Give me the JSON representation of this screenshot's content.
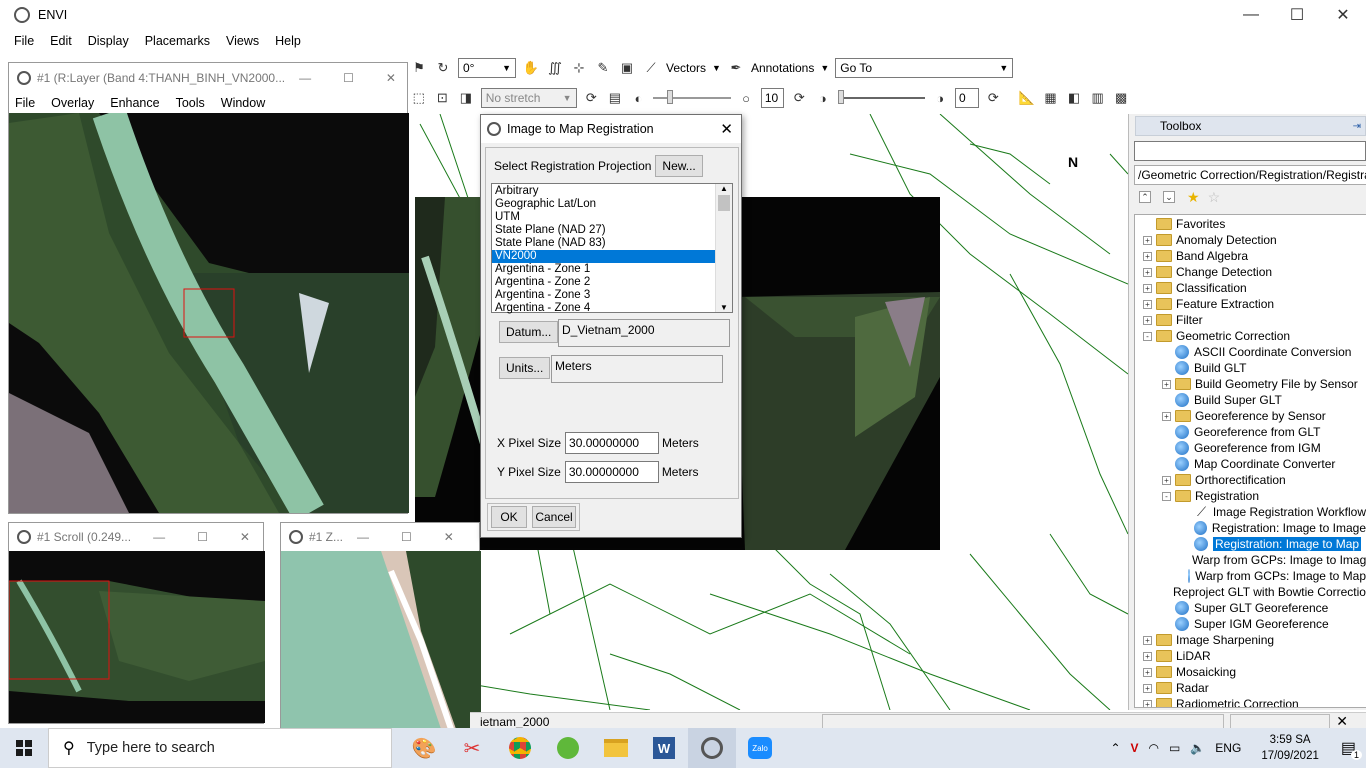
{
  "main_window": {
    "title": "ENVI",
    "menu": [
      "File",
      "Edit",
      "Display",
      "Placemarks",
      "Views",
      "Help"
    ],
    "controls": [
      "—",
      "☐",
      "✕"
    ]
  },
  "toolbar": {
    "rotation": "0°",
    "vectors": "Vectors",
    "annotations": "Annotations",
    "goto": "Go To",
    "stretch": "No stretch",
    "brightness_val": "10",
    "transparency_val": "0"
  },
  "layer_window": {
    "title": "#1 (R:Layer (Band 4:THANH_BINH_VN2000...",
    "menu": [
      "File",
      "Overlay",
      "Enhance",
      "Tools",
      "Window"
    ]
  },
  "scroll_window": {
    "title": "#1 Scroll (0.249..."
  },
  "zoom_window": {
    "title": "#1 Z..."
  },
  "dialog": {
    "title": "Image to Map Registration",
    "select_label": "Select Registration Projection",
    "new_button": "New...",
    "projections": [
      "Arbitrary",
      "Geographic Lat/Lon",
      "UTM",
      "State Plane (NAD 27)",
      "State Plane (NAD 83)",
      "VN2000",
      "Argentina - Zone 1",
      "Argentina - Zone 2",
      "Argentina - Zone 3",
      "Argentina - Zone 4"
    ],
    "selected_projection": "VN2000",
    "datum_button": "Datum...",
    "datum_value": "D_Vietnam_2000",
    "units_button": "Units...",
    "units_value": "Meters",
    "x_pixel_label": "X Pixel Size",
    "x_pixel_value": "30.00000000",
    "x_pixel_unit": "Meters",
    "y_pixel_label": "Y Pixel Size",
    "y_pixel_value": "30.00000000",
    "y_pixel_unit": "Meters",
    "ok_button": "OK",
    "cancel_button": "Cancel"
  },
  "toolbox": {
    "title": "Toolbox",
    "path": "/Geometric Correction/Registration/Registration:",
    "items": [
      {
        "label": "Favorites",
        "level": 0,
        "type": "folder",
        "exp": ""
      },
      {
        "label": "Anomaly Detection",
        "level": 0,
        "type": "folder",
        "exp": "+"
      },
      {
        "label": "Band Algebra",
        "level": 0,
        "type": "folder",
        "exp": "+"
      },
      {
        "label": "Change Detection",
        "level": 0,
        "type": "folder",
        "exp": "+"
      },
      {
        "label": "Classification",
        "level": 0,
        "type": "folder",
        "exp": "+"
      },
      {
        "label": "Feature Extraction",
        "level": 0,
        "type": "folder",
        "exp": "+"
      },
      {
        "label": "Filter",
        "level": 0,
        "type": "folder",
        "exp": "+"
      },
      {
        "label": "Geometric Correction",
        "level": 0,
        "type": "folder",
        "exp": "-"
      },
      {
        "label": "ASCII Coordinate Conversion",
        "level": 1,
        "type": "tool",
        "exp": ""
      },
      {
        "label": "Build GLT",
        "level": 1,
        "type": "tool",
        "exp": ""
      },
      {
        "label": "Build Geometry File by Sensor",
        "level": 1,
        "type": "folder",
        "exp": "+"
      },
      {
        "label": "Build Super GLT",
        "level": 1,
        "type": "tool",
        "exp": ""
      },
      {
        "label": "Georeference by Sensor",
        "level": 1,
        "type": "folder",
        "exp": "+"
      },
      {
        "label": "Georeference from GLT",
        "level": 1,
        "type": "tool",
        "exp": ""
      },
      {
        "label": "Georeference from IGM",
        "level": 1,
        "type": "tool",
        "exp": ""
      },
      {
        "label": "Map Coordinate Converter",
        "level": 1,
        "type": "tool",
        "exp": ""
      },
      {
        "label": "Orthorectification",
        "level": 1,
        "type": "folder",
        "exp": "+"
      },
      {
        "label": "Registration",
        "level": 1,
        "type": "folder",
        "exp": "-"
      },
      {
        "label": "Image Registration Workflow",
        "level": 2,
        "type": "wand",
        "exp": ""
      },
      {
        "label": "Registration: Image to Image",
        "level": 2,
        "type": "tool",
        "exp": ""
      },
      {
        "label": "Registration: Image to Map",
        "level": 2,
        "type": "tool",
        "exp": "",
        "selected": true
      },
      {
        "label": "Warp from GCPs: Image to Image",
        "level": 2,
        "type": "tool",
        "exp": ""
      },
      {
        "label": "Warp from GCPs: Image to Map",
        "level": 2,
        "type": "tool",
        "exp": ""
      },
      {
        "label": "Reproject GLT with Bowtie Correction",
        "level": 1,
        "type": "tool",
        "exp": ""
      },
      {
        "label": "Super GLT Georeference",
        "level": 1,
        "type": "tool",
        "exp": ""
      },
      {
        "label": "Super IGM Georeference",
        "level": 1,
        "type": "tool",
        "exp": ""
      },
      {
        "label": "Image Sharpening",
        "level": 0,
        "type": "folder",
        "exp": "+"
      },
      {
        "label": "LiDAR",
        "level": 0,
        "type": "folder",
        "exp": "+"
      },
      {
        "label": "Mosaicking",
        "level": 0,
        "type": "folder",
        "exp": "+"
      },
      {
        "label": "Radar",
        "level": 0,
        "type": "folder",
        "exp": "+"
      },
      {
        "label": "Radiometric Correction",
        "level": 0,
        "type": "folder",
        "exp": "+"
      }
    ]
  },
  "statusbar": {
    "text": "ietnam_2000"
  },
  "taskbar": {
    "search_placeholder": "Type here to search",
    "language": "ENG",
    "time": "3:59 SA",
    "date": "17/09/2021",
    "notification_count": "1"
  },
  "colors": {
    "selection": "#0078d7",
    "vector": "#1a7a1a",
    "dark_bg": "#0d0d0d"
  }
}
